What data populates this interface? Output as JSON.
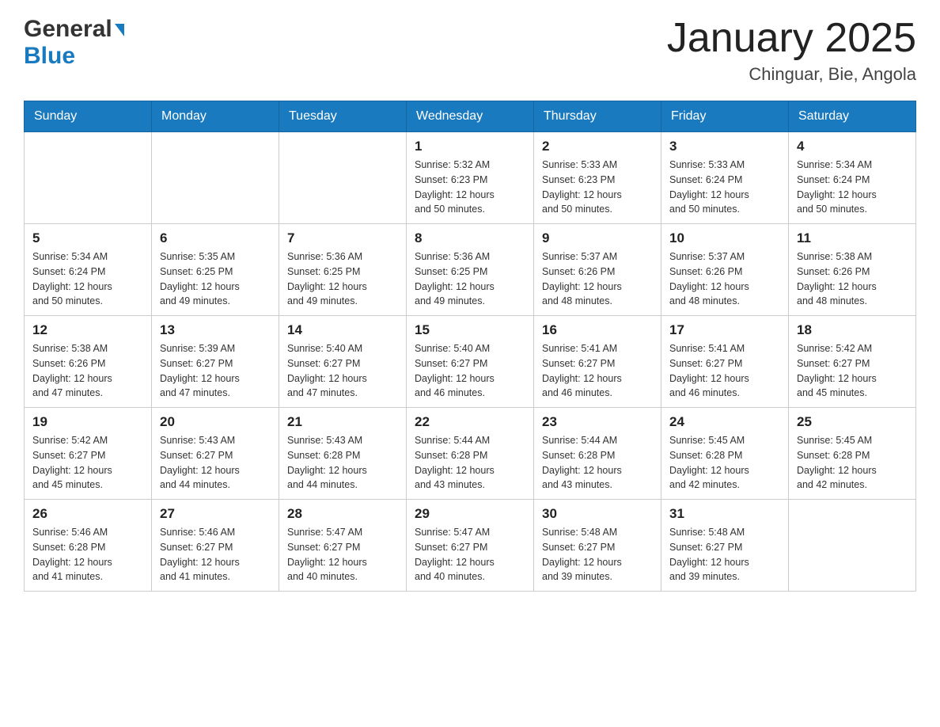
{
  "header": {
    "logo_general": "General",
    "logo_blue": "Blue",
    "month_title": "January 2025",
    "location": "Chinguar, Bie, Angola"
  },
  "weekdays": [
    "Sunday",
    "Monday",
    "Tuesday",
    "Wednesday",
    "Thursday",
    "Friday",
    "Saturday"
  ],
  "weeks": [
    [
      {
        "day": "",
        "info": ""
      },
      {
        "day": "",
        "info": ""
      },
      {
        "day": "",
        "info": ""
      },
      {
        "day": "1",
        "info": "Sunrise: 5:32 AM\nSunset: 6:23 PM\nDaylight: 12 hours\nand 50 minutes."
      },
      {
        "day": "2",
        "info": "Sunrise: 5:33 AM\nSunset: 6:23 PM\nDaylight: 12 hours\nand 50 minutes."
      },
      {
        "day": "3",
        "info": "Sunrise: 5:33 AM\nSunset: 6:24 PM\nDaylight: 12 hours\nand 50 minutes."
      },
      {
        "day": "4",
        "info": "Sunrise: 5:34 AM\nSunset: 6:24 PM\nDaylight: 12 hours\nand 50 minutes."
      }
    ],
    [
      {
        "day": "5",
        "info": "Sunrise: 5:34 AM\nSunset: 6:24 PM\nDaylight: 12 hours\nand 50 minutes."
      },
      {
        "day": "6",
        "info": "Sunrise: 5:35 AM\nSunset: 6:25 PM\nDaylight: 12 hours\nand 49 minutes."
      },
      {
        "day": "7",
        "info": "Sunrise: 5:36 AM\nSunset: 6:25 PM\nDaylight: 12 hours\nand 49 minutes."
      },
      {
        "day": "8",
        "info": "Sunrise: 5:36 AM\nSunset: 6:25 PM\nDaylight: 12 hours\nand 49 minutes."
      },
      {
        "day": "9",
        "info": "Sunrise: 5:37 AM\nSunset: 6:26 PM\nDaylight: 12 hours\nand 48 minutes."
      },
      {
        "day": "10",
        "info": "Sunrise: 5:37 AM\nSunset: 6:26 PM\nDaylight: 12 hours\nand 48 minutes."
      },
      {
        "day": "11",
        "info": "Sunrise: 5:38 AM\nSunset: 6:26 PM\nDaylight: 12 hours\nand 48 minutes."
      }
    ],
    [
      {
        "day": "12",
        "info": "Sunrise: 5:38 AM\nSunset: 6:26 PM\nDaylight: 12 hours\nand 47 minutes."
      },
      {
        "day": "13",
        "info": "Sunrise: 5:39 AM\nSunset: 6:27 PM\nDaylight: 12 hours\nand 47 minutes."
      },
      {
        "day": "14",
        "info": "Sunrise: 5:40 AM\nSunset: 6:27 PM\nDaylight: 12 hours\nand 47 minutes."
      },
      {
        "day": "15",
        "info": "Sunrise: 5:40 AM\nSunset: 6:27 PM\nDaylight: 12 hours\nand 46 minutes."
      },
      {
        "day": "16",
        "info": "Sunrise: 5:41 AM\nSunset: 6:27 PM\nDaylight: 12 hours\nand 46 minutes."
      },
      {
        "day": "17",
        "info": "Sunrise: 5:41 AM\nSunset: 6:27 PM\nDaylight: 12 hours\nand 46 minutes."
      },
      {
        "day": "18",
        "info": "Sunrise: 5:42 AM\nSunset: 6:27 PM\nDaylight: 12 hours\nand 45 minutes."
      }
    ],
    [
      {
        "day": "19",
        "info": "Sunrise: 5:42 AM\nSunset: 6:27 PM\nDaylight: 12 hours\nand 45 minutes."
      },
      {
        "day": "20",
        "info": "Sunrise: 5:43 AM\nSunset: 6:27 PM\nDaylight: 12 hours\nand 44 minutes."
      },
      {
        "day": "21",
        "info": "Sunrise: 5:43 AM\nSunset: 6:28 PM\nDaylight: 12 hours\nand 44 minutes."
      },
      {
        "day": "22",
        "info": "Sunrise: 5:44 AM\nSunset: 6:28 PM\nDaylight: 12 hours\nand 43 minutes."
      },
      {
        "day": "23",
        "info": "Sunrise: 5:44 AM\nSunset: 6:28 PM\nDaylight: 12 hours\nand 43 minutes."
      },
      {
        "day": "24",
        "info": "Sunrise: 5:45 AM\nSunset: 6:28 PM\nDaylight: 12 hours\nand 42 minutes."
      },
      {
        "day": "25",
        "info": "Sunrise: 5:45 AM\nSunset: 6:28 PM\nDaylight: 12 hours\nand 42 minutes."
      }
    ],
    [
      {
        "day": "26",
        "info": "Sunrise: 5:46 AM\nSunset: 6:28 PM\nDaylight: 12 hours\nand 41 minutes."
      },
      {
        "day": "27",
        "info": "Sunrise: 5:46 AM\nSunset: 6:27 PM\nDaylight: 12 hours\nand 41 minutes."
      },
      {
        "day": "28",
        "info": "Sunrise: 5:47 AM\nSunset: 6:27 PM\nDaylight: 12 hours\nand 40 minutes."
      },
      {
        "day": "29",
        "info": "Sunrise: 5:47 AM\nSunset: 6:27 PM\nDaylight: 12 hours\nand 40 minutes."
      },
      {
        "day": "30",
        "info": "Sunrise: 5:48 AM\nSunset: 6:27 PM\nDaylight: 12 hours\nand 39 minutes."
      },
      {
        "day": "31",
        "info": "Sunrise: 5:48 AM\nSunset: 6:27 PM\nDaylight: 12 hours\nand 39 minutes."
      },
      {
        "day": "",
        "info": ""
      }
    ]
  ]
}
